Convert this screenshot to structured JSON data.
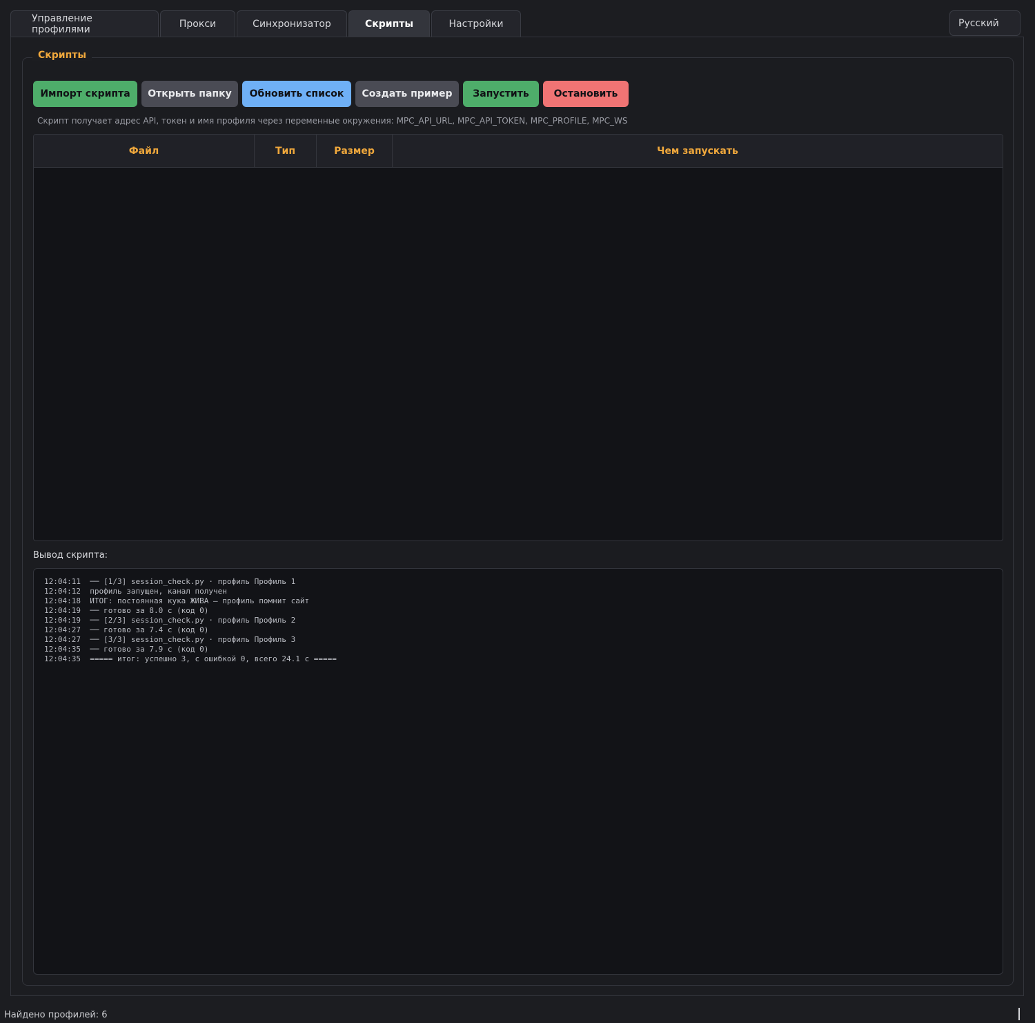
{
  "tabs": [
    {
      "label": "Управление профилями"
    },
    {
      "label": "Прокси"
    },
    {
      "label": "Синхронизатор"
    },
    {
      "label": "Скрипты",
      "active": true
    },
    {
      "label": "Настройки"
    }
  ],
  "language": {
    "selected": "Русский"
  },
  "scripts_group": {
    "title": "Скрипты",
    "buttons": {
      "import": "Импорт скрипта",
      "open_folder": "Открыть папку",
      "refresh": "Обновить список",
      "create_example": "Создать пример",
      "run": "Запустить",
      "stop": "Остановить"
    },
    "hint": "Скрипт получает адрес API, токен и имя профиля через переменные окружения: MPC_API_URL, MPC_API_TOKEN, MPC_PROFILE, MPC_WS",
    "table": {
      "columns": [
        "Файл",
        "Тип",
        "Размер",
        "Чем запускать"
      ],
      "rows": []
    },
    "output_label": "Вывод скрипта:",
    "output_lines": [
      {
        "time": "12:04:11",
        "text": "── [1/3] session_check.py · профиль Профиль 1"
      },
      {
        "time": "12:04:12",
        "text": "профиль запущен, канал получен"
      },
      {
        "time": "12:04:18",
        "text": "ИТОГ: постоянная кука ЖИВА — профиль помнит сайт"
      },
      {
        "time": "12:04:19",
        "text": "── готово за 8.0 с (код 0)"
      },
      {
        "time": "12:04:19",
        "text": "── [2/3] session_check.py · профиль Профиль 2"
      },
      {
        "time": "12:04:27",
        "text": "── готово за 7.4 с (код 0)"
      },
      {
        "time": "12:04:27",
        "text": "── [3/3] session_check.py · профиль Профиль 3"
      },
      {
        "time": "12:04:35",
        "text": "── готово за 7.9 с (код 0)"
      },
      {
        "time": "12:04:35",
        "text": "===== итог: успешно 3, с ошибкой 0, всего 24.1 с ====="
      }
    ]
  },
  "status_bar": {
    "text": "Найдено профилей: 6"
  },
  "colors": {
    "accent": "#f0a83c",
    "success": "#4ead6a",
    "info": "#6fb0f6",
    "danger": "#f07474",
    "background": "#1c1d21"
  }
}
